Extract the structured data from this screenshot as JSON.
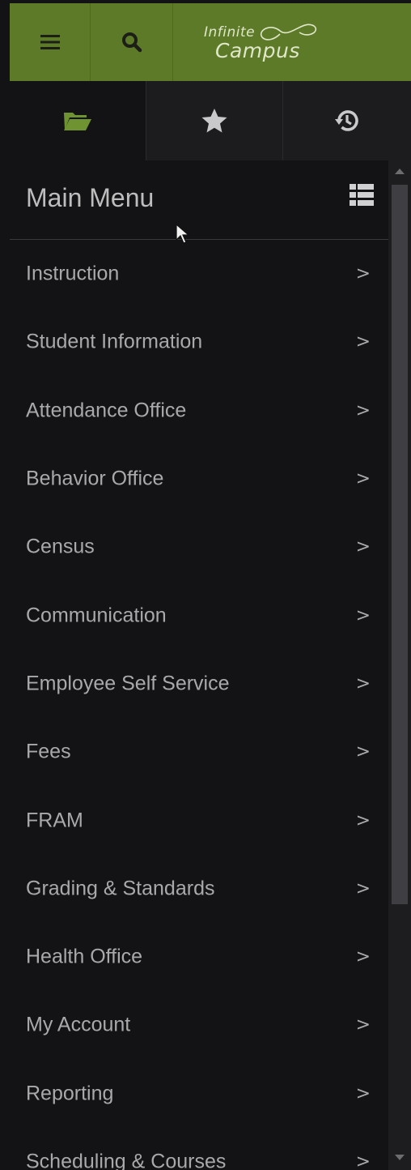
{
  "topbar": {
    "menu_icon": "hamburger-icon",
    "search_icon": "search-icon",
    "logo_line1": "Infinite",
    "logo_line2": "Campus",
    "brand_color": "#5d7a29"
  },
  "tabs": [
    {
      "name": "menu",
      "icon": "folder-open-icon",
      "active": true
    },
    {
      "name": "favorites",
      "icon": "star-icon",
      "active": false
    },
    {
      "name": "history",
      "icon": "history-icon",
      "active": false
    }
  ],
  "menu": {
    "title": "Main Menu",
    "view_icon": "list-view-icon",
    "items": [
      {
        "label": "Instruction"
      },
      {
        "label": "Student Information"
      },
      {
        "label": "Attendance Office"
      },
      {
        "label": "Behavior Office"
      },
      {
        "label": "Census"
      },
      {
        "label": "Communication"
      },
      {
        "label": "Employee Self Service"
      },
      {
        "label": "Fees"
      },
      {
        "label": "FRAM"
      },
      {
        "label": "Grading & Standards"
      },
      {
        "label": "Health Office"
      },
      {
        "label": "My Account"
      },
      {
        "label": "Reporting"
      },
      {
        "label": "Scheduling & Courses"
      }
    ],
    "chevron": ">"
  }
}
